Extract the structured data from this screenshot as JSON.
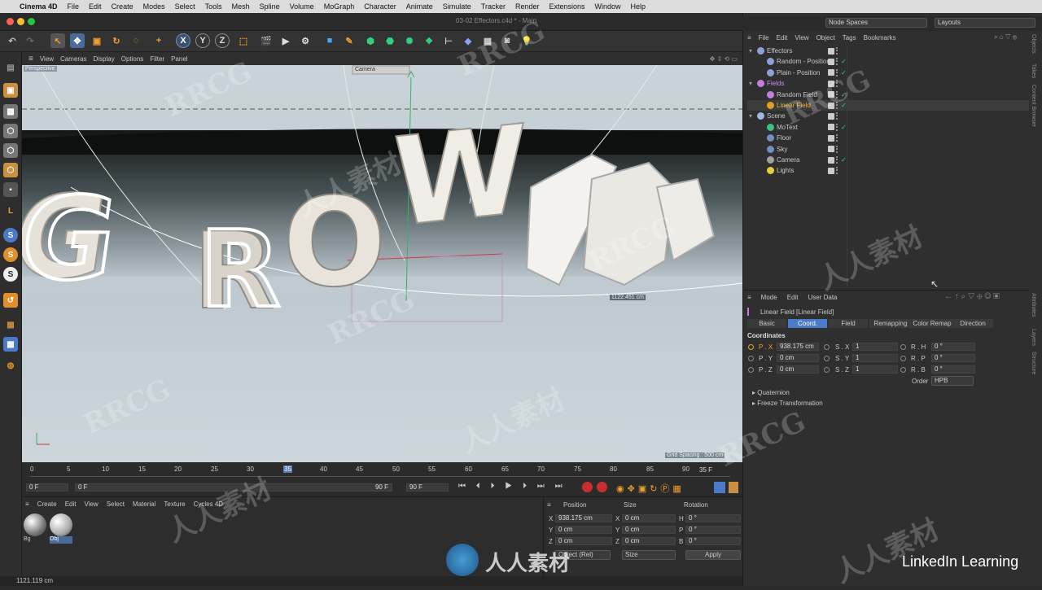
{
  "mac": {
    "app": "Cinema 4D",
    "menu": [
      "File",
      "Edit",
      "Create",
      "Modes",
      "Select",
      "Tools",
      "Mesh",
      "Spline",
      "Volume",
      "MoGraph",
      "Character",
      "Animate",
      "Simulate",
      "Tracker",
      "Render",
      "Extensions",
      "Window",
      "Help"
    ]
  },
  "window": {
    "title": "03-02 Effectors.c4d * - Main",
    "node_spaces": "Node Spaces",
    "layouts": "Layouts"
  },
  "viewport": {
    "menu": [
      "View",
      "Cameras",
      "Display",
      "Options",
      "Filter",
      "Panel"
    ],
    "label": "Perspective",
    "camera": "Camera",
    "distance": "1122.451 cm",
    "grid": "Grid Spacing : 500 cm",
    "scene_text": "GROWTH"
  },
  "timeline": {
    "ticks": [
      "0",
      "5",
      "10",
      "15",
      "20",
      "25",
      "30",
      "35",
      "40",
      "45",
      "50",
      "55",
      "60",
      "65",
      "70",
      "75",
      "80",
      "85",
      "90"
    ],
    "current": "35 F",
    "start": "0 F",
    "start2": "0 F",
    "end": "90 F",
    "end2": "90 F"
  },
  "materials": {
    "menu": [
      "Create",
      "Edit",
      "View",
      "Select",
      "Material",
      "Texture",
      "Cycles 4D"
    ],
    "items": [
      "Bg",
      "Obj"
    ]
  },
  "coords": {
    "headers": [
      "Position",
      "Size",
      "Rotation"
    ],
    "rows": [
      {
        "a": "X",
        "pos": "938.175 cm",
        "s": "X",
        "size": "0 cm",
        "r": "H",
        "rot": "0 °"
      },
      {
        "a": "Y",
        "pos": "0 cm",
        "s": "Y",
        "size": "0 cm",
        "r": "P",
        "rot": "0 °"
      },
      {
        "a": "Z",
        "pos": "0 cm",
        "s": "Z",
        "size": "0 cm",
        "r": "B",
        "rot": "0 °"
      }
    ],
    "mode": "Object (Rel)",
    "size_mode": "Size",
    "apply": "Apply"
  },
  "status": "1121.119 cm",
  "objects": {
    "menu": [
      "File",
      "Edit",
      "View",
      "Object",
      "Tags",
      "Bookmarks"
    ],
    "rows": [
      {
        "name": "Effectors",
        "indent": 0,
        "color": "#8fa0d8"
      },
      {
        "name": "Random - Position",
        "indent": 1,
        "color": "#8fa0d8"
      },
      {
        "name": "Plain - Position",
        "indent": 1,
        "color": "#8fa0d8"
      },
      {
        "name": "Fields",
        "indent": 0,
        "color": "#c080e0"
      },
      {
        "name": "Random Field",
        "indent": 1,
        "color": "#c080e0"
      },
      {
        "name": "Linear Field",
        "indent": 1,
        "color": "#e0a020"
      },
      {
        "name": "Scene",
        "indent": 0,
        "color": "#a0b8e0"
      },
      {
        "name": "MoText",
        "indent": 1,
        "color": "#40c080"
      },
      {
        "name": "Floor",
        "indent": 1,
        "color": "#7090c0"
      },
      {
        "name": "Sky",
        "indent": 1,
        "color": "#7090c0"
      },
      {
        "name": "Camera",
        "indent": 1,
        "color": "#a0a0a0"
      },
      {
        "name": "Lights",
        "indent": 1,
        "color": "#e0d040"
      }
    ]
  },
  "attributes": {
    "menu": [
      "Mode",
      "Edit",
      "User Data"
    ],
    "title": "Linear Field [Linear Field]",
    "tabs": [
      "Basic",
      "Coord.",
      "Field",
      "Remapping",
      "Color Remap",
      "Direction"
    ],
    "section": "Coordinates",
    "rows": [
      {
        "p": "P . X",
        "pv": "938.175 cm",
        "s": "S . X",
        "sv": "1",
        "r": "R . H",
        "rv": "0 °"
      },
      {
        "p": "P . Y",
        "pv": "0 cm",
        "s": "S . Y",
        "sv": "1",
        "r": "R . P",
        "rv": "0 °"
      },
      {
        "p": "P . Z",
        "pv": "0 cm",
        "s": "S . Z",
        "sv": "1",
        "r": "R . B",
        "rv": "0 °"
      }
    ],
    "order_label": "Order",
    "order": "HPB",
    "groups": [
      "Quaternion",
      "Freeze Transformation"
    ]
  },
  "side_tabs": [
    "Objects",
    "Takes",
    "Content Browser",
    "Attributes",
    "Layers",
    "Structure"
  ],
  "watermarks": {
    "a": "RRCG",
    "b": "人人素材"
  },
  "brand": "LinkedIn Learning"
}
